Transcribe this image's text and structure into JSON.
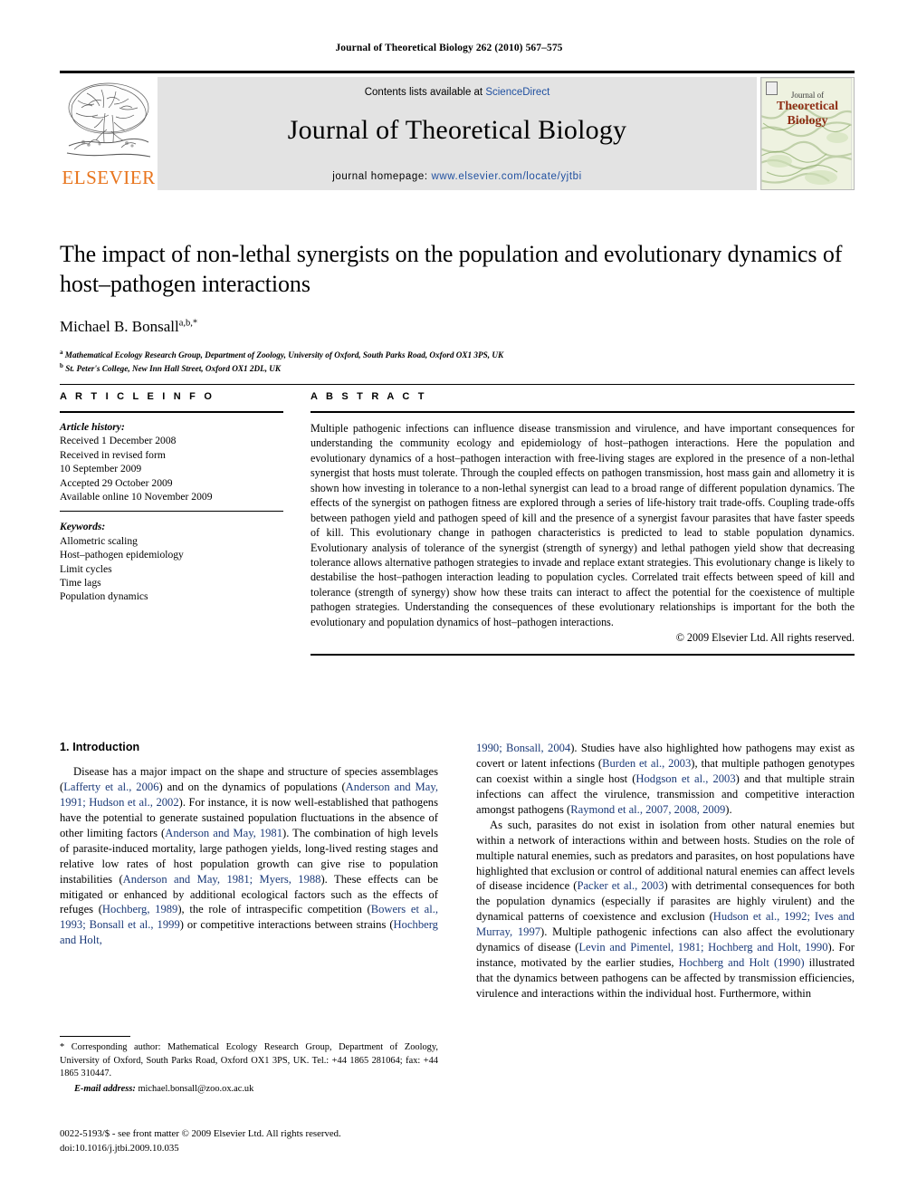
{
  "running_head": "Journal of Theoretical Biology 262 (2010) 567–575",
  "masthead": {
    "contents_prefix": "Contents lists available at ",
    "sciencedirect": "ScienceDirect",
    "journal_title": "Journal of Theoretical Biology",
    "homepage_prefix": "journal homepage: ",
    "homepage_url": "www.elsevier.com/locate/yjtbi",
    "publisher": "ELSEVIER",
    "cover": {
      "line1": "Journal of",
      "line2": "Theoretical",
      "line3": "Biology"
    },
    "link_color": "#2050a0",
    "publisher_color": "#E8741C"
  },
  "article": {
    "title": "The impact of non-lethal synergists on the population and evolutionary dynamics of host–pathogen interactions",
    "author": "Michael B. Bonsall",
    "author_sup": "a,b,*",
    "affiliation_a_sup": "a",
    "affiliation_a": "Mathematical Ecology Research Group, Department of Zoology, University of Oxford, South Parks Road, Oxford OX1 3PS, UK",
    "affiliation_b_sup": "b",
    "affiliation_b": "St. Peter's College, New Inn Hall Street, Oxford OX1 2DL, UK"
  },
  "article_info": {
    "heading": "A R T I C L E   I N F O",
    "history_label": "Article history:",
    "history": [
      "Received 1 December 2008",
      "Received in revised form",
      "10 September 2009",
      "Accepted 29 October 2009",
      "Available online 10 November 2009"
    ],
    "keywords_label": "Keywords:",
    "keywords": [
      "Allometric scaling",
      "Host–pathogen epidemiology",
      "Limit cycles",
      "Time lags",
      "Population dynamics"
    ]
  },
  "abstract": {
    "heading": "A B S T R A C T",
    "text": "Multiple pathogenic infections can influence disease transmission and virulence, and have important consequences for understanding the community ecology and epidemiology of host–pathogen interactions. Here the population and evolutionary dynamics of a host–pathogen interaction with free-living stages are explored in the presence of a non-lethal synergist that hosts must tolerate. Through the coupled effects on pathogen transmission, host mass gain and allometry it is shown how investing in tolerance to a non-lethal synergist can lead to a broad range of different population dynamics. The effects of the synergist on pathogen fitness are explored through a series of life-history trait trade-offs. Coupling trade-offs between pathogen yield and pathogen speed of kill and the presence of a synergist favour parasites that have faster speeds of kill. This evolutionary change in pathogen characteristics is predicted to lead to stable population dynamics. Evolutionary analysis of tolerance of the synergist (strength of synergy) and lethal pathogen yield show that decreasing tolerance allows alternative pathogen strategies to invade and replace extant strategies. This evolutionary change is likely to destabilise the host–pathogen interaction leading to population cycles. Correlated trait effects between speed of kill and tolerance (strength of synergy) show how these traits can interact to affect the potential for the coexistence of multiple pathogen strategies. Understanding the consequences of these evolutionary relationships is important for the both the evolutionary and population dynamics of host–pathogen interactions.",
    "copyright": "© 2009 Elsevier Ltd. All rights reserved."
  },
  "introduction": {
    "heading": "1.  Introduction",
    "left_paragraph_1_parts": [
      {
        "t": "Disease has a major impact on the shape and structure of species assemblages ("
      },
      {
        "t": "Lafferty et al., 2006",
        "c": true
      },
      {
        "t": ") and on the dynamics of populations ("
      },
      {
        "t": "Anderson and May, 1991; Hudson et al., 2002",
        "c": true
      },
      {
        "t": "). For instance, it is now well-established that pathogens have the potential to generate sustained population fluctuations in the absence of other limiting factors ("
      },
      {
        "t": "Anderson and May, 1981",
        "c": true
      },
      {
        "t": "). The combination of high levels of parasite-induced mortality, large pathogen yields, long-lived resting stages and relative low rates of host population growth can give rise to population instabilities ("
      },
      {
        "t": "Anderson and May, 1981; Myers, 1988",
        "c": true
      },
      {
        "t": "). These effects can be mitigated or enhanced by additional ecological factors such as the effects of refuges ("
      },
      {
        "t": "Hochberg, 1989",
        "c": true
      },
      {
        "t": "), the role of intraspecific competition ("
      },
      {
        "t": "Bowers et al., 1993; Bonsall et al., 1999",
        "c": true
      },
      {
        "t": ") or competitive interactions between strains ("
      },
      {
        "t": "Hochberg and Holt,",
        "c": true
      }
    ],
    "right_paragraph_1_parts": [
      {
        "t": "1990; Bonsall, 2004",
        "c": true
      },
      {
        "t": "). Studies have also highlighted how pathogens may exist as covert or latent infections ("
      },
      {
        "t": "Burden et al., 2003",
        "c": true
      },
      {
        "t": "), that multiple pathogen genotypes can coexist within a single host ("
      },
      {
        "t": "Hodgson et al., 2003",
        "c": true
      },
      {
        "t": ") and that multiple strain infections can affect the virulence, transmission and competitive interaction amongst pathogens ("
      },
      {
        "t": "Raymond et al., 2007, 2008, 2009",
        "c": true
      },
      {
        "t": ")."
      }
    ],
    "right_paragraph_2_parts": [
      {
        "t": "As such, parasites do not exist in isolation from other natural enemies but within a network of interactions within and between hosts. Studies on the role of multiple natural enemies, such as predators and parasites, on host populations have highlighted that exclusion or control of additional natural enemies can affect levels of disease incidence ("
      },
      {
        "t": "Packer et al., 2003",
        "c": true
      },
      {
        "t": ") with detrimental consequences for both the population dynamics (especially if parasites are highly virulent) and the dynamical patterns of coexistence and exclusion ("
      },
      {
        "t": "Hudson et al., 1992; Ives and Murray, 1997",
        "c": true
      },
      {
        "t": "). Multiple pathogenic infections can also affect the evolutionary dynamics of disease ("
      },
      {
        "t": "Levin and Pimentel, 1981; Hochberg and Holt, 1990",
        "c": true
      },
      {
        "t": "). For instance, motivated by the earlier studies, "
      },
      {
        "t": "Hochberg and Holt (1990)",
        "c": true
      },
      {
        "t": " illustrated that the dynamics between pathogens can be affected by transmission efficiencies, virulence and interactions within the individual host. Furthermore, within"
      }
    ],
    "citation_color": "#1b3a78"
  },
  "footnotes": {
    "corresponding": "* Corresponding author: Mathematical Ecology Research Group, Department of Zoology, University of Oxford, South Parks Road, Oxford OX1 3PS, UK. Tel.: +44 1865 281064; fax: +44 1865 310447.",
    "email_label": "E-mail address:",
    "email": "michael.bonsall@zoo.ox.ac.uk"
  },
  "imprint": {
    "issn_line": "0022-5193/$ - see front matter © 2009 Elsevier Ltd. All rights reserved.",
    "doi_line": "doi:10.1016/j.jtbi.2009.10.035"
  }
}
